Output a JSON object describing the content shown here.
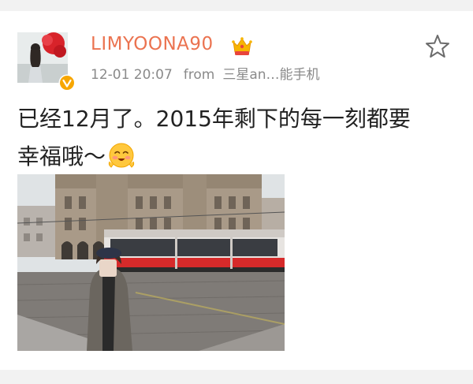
{
  "post": {
    "username": "LIMYOONA90",
    "time": "12-01 20:07",
    "from_label": "from",
    "source": "三星an…能手机",
    "text_line1": "已经12月了。2015年剩下的每一刻都要",
    "text_line2": "幸福哦～"
  },
  "icons": {
    "avatar": "avatar",
    "verified": "verified-badge-icon",
    "vip": "crown-icon",
    "favorite": "star-icon",
    "emoji": "happy-blush-emoji-icon"
  },
  "colors": {
    "username": "#eb7350",
    "meta": "#8a8a8a",
    "text": "#222222",
    "verified_badge": "#f7a600"
  }
}
